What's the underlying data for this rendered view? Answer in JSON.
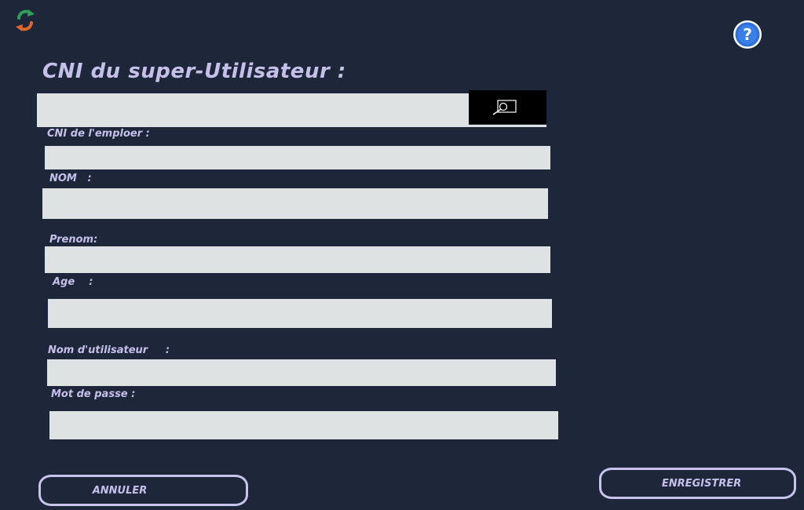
{
  "title": "CNI du super-Utilisateur :",
  "icons": {
    "refresh": "refresh-icon",
    "help": "help-icon",
    "search": "search-icon"
  },
  "search": {
    "value": "",
    "placeholder": ""
  },
  "form": {
    "cni_label": "CNI de l'emploer :",
    "cni_value": "",
    "nom_label": "NOM   :",
    "nom_value": "",
    "prenom_label": "Prenom:",
    "prenom_value": "",
    "age_label": "Age    :",
    "age_value": "",
    "username_label": "Nom d'utilisateur     :",
    "username_value": "",
    "password_label": "Mot de passe :",
    "password_value": ""
  },
  "buttons": {
    "cancel": "ANNULER",
    "save": "ENREGISTRER"
  },
  "colors": {
    "background": "#1e263a",
    "text": "#c5c0ea",
    "field": "#dfe2e3",
    "button_border": "#c9c3ee"
  }
}
